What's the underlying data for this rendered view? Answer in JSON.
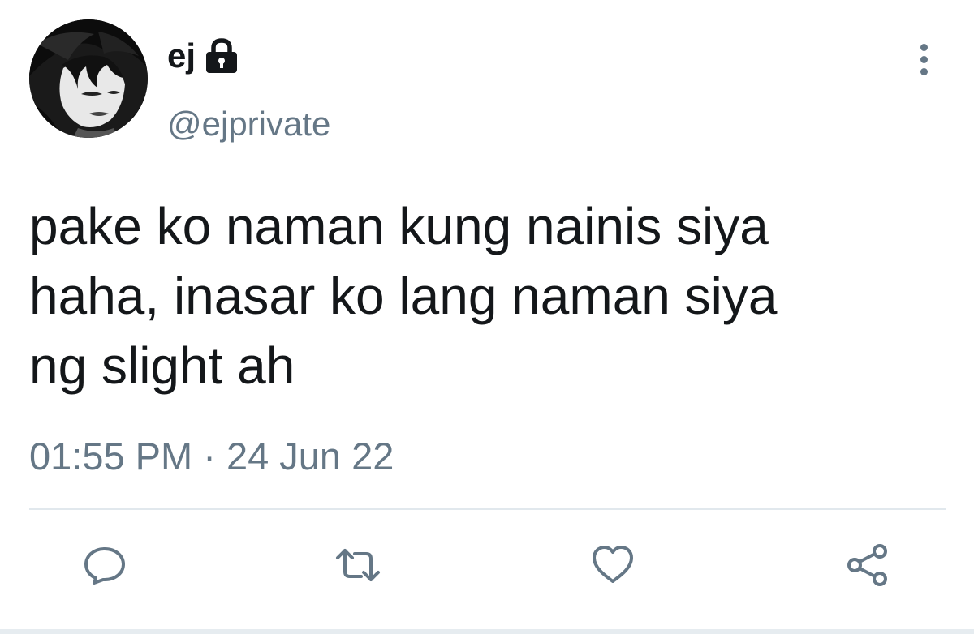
{
  "user": {
    "display_name": "ej",
    "handle": "@ejprivate",
    "protected_icon": "lock-icon",
    "avatar": "user-avatar"
  },
  "tweet": {
    "lines": [
      "pake ko naman kung nainis siya",
      "haha, inasar ko lang naman siya",
      "ng slight ah"
    ],
    "timestamp": "01:55 PM · 24 Jun 22"
  },
  "actions": [
    {
      "name": "reply",
      "icon": "speech-bubble-icon"
    },
    {
      "name": "retweet",
      "icon": "retweet-icon"
    },
    {
      "name": "like",
      "icon": "heart-icon"
    },
    {
      "name": "share",
      "icon": "share-icon"
    }
  ],
  "menu": {
    "icon": "more-vertical-icon"
  },
  "colors": {
    "text": "#14171a",
    "secondary": "#657786",
    "divider": "#e1e8ed",
    "background": "#ffffff"
  }
}
